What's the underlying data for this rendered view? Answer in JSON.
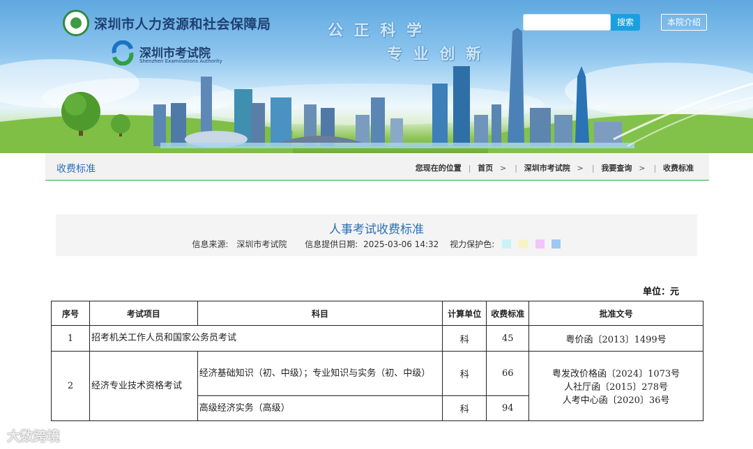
{
  "header": {
    "org_name": "深圳市人力资源和社会保障局",
    "sub_org_name": "深圳市考试院",
    "sub_org_en": "Shenzhen Examinations Authority",
    "slogan_line1": "公 正   科 学",
    "slogan_line2": "专 业   创 新",
    "search_placeholder": "",
    "search_button": "搜索",
    "intro_button": "本院介绍"
  },
  "breadcrumb_bar": {
    "title": "收费标准",
    "location_label": "您现在的位置",
    "items": [
      "首页",
      "深圳市考试院",
      "我要查询",
      "收费标准"
    ],
    "arrow": ">"
  },
  "article": {
    "title": "人事考试收费标准",
    "source_label": "信息来源:",
    "source_value": "深圳市考试院",
    "date_label": "信息提供日期:",
    "date_value": "2025-03-06 14:32",
    "eye_care_label": "视力保护色:",
    "eye_care_colors": [
      "#c9f3f7",
      "#f7f4c2",
      "#f3c4f6",
      "#9bc9f3"
    ]
  },
  "table": {
    "unit": "单位：元",
    "headers": [
      "序号",
      "考试项目",
      "科目",
      "计算单位",
      "收费标准",
      "批准文号"
    ],
    "row1": {
      "no": "1",
      "item": "招考机关工作人员和国家公务员考试",
      "unit": "科",
      "fee": "45",
      "approval": "粤价函〔2013〕1499号"
    },
    "row2": {
      "no": "2",
      "item": "经济专业技术资格考试",
      "subject_a": "经济基础知识（初、中级）；专业知识与实务（初、中级）",
      "unit_a": "科",
      "fee_a": "66",
      "subject_b": "高级经济实务（高级）",
      "unit_b": "科",
      "fee_b": "94",
      "approval_1": "粤发改价格函〔2024〕1073号",
      "approval_2": "人社厅函〔2015〕278号",
      "approval_3": "人考中心函〔2020〕36号"
    }
  },
  "watermark": "大数跨境"
}
